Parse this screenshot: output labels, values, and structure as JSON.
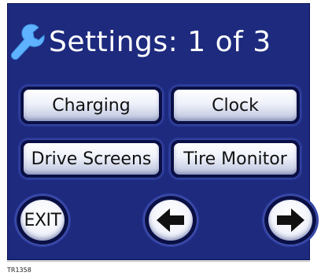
{
  "screen": {
    "title": "Settings: 1 of 3",
    "title_icon": "wrench-icon",
    "background_color": "#1d2a7e"
  },
  "menu": {
    "buttons": [
      {
        "label": "Charging"
      },
      {
        "label": "Clock"
      },
      {
        "label": "Drive Screens"
      },
      {
        "label": "Tire Monitor"
      }
    ]
  },
  "nav": {
    "exit_label": "EXIT",
    "back_icon": "arrow-left-icon",
    "forward_icon": "arrow-right-icon"
  },
  "figure": {
    "caption": "TR1358"
  }
}
